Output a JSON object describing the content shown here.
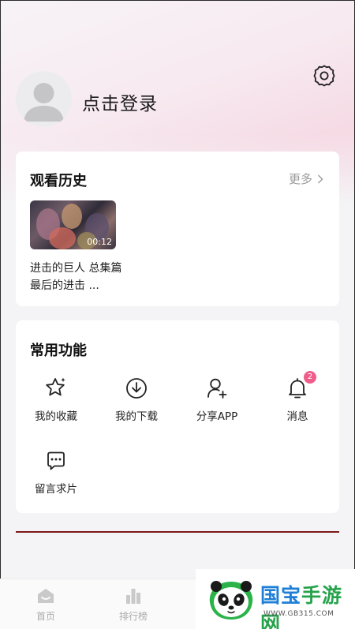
{
  "header": {
    "login_label": "点击登录",
    "settings_icon": "gear-icon",
    "avatar_icon": "default-avatar-icon"
  },
  "history": {
    "title": "观看历史",
    "more_label": "更多",
    "video": {
      "duration": "00:12",
      "title": "进击的巨人 总集篇 最后的进击 ..."
    }
  },
  "functions": {
    "title": "常用功能",
    "items": [
      {
        "label": "我的收藏",
        "icon": "star-icon"
      },
      {
        "label": "我的下载",
        "icon": "download-icon"
      },
      {
        "label": "分享APP",
        "icon": "add-user-icon"
      },
      {
        "label": "消息",
        "icon": "bell-icon",
        "badge": "2"
      },
      {
        "label": "留言求片",
        "icon": "message-icon"
      }
    ]
  },
  "tabbar": {
    "items": [
      {
        "label": "首页",
        "icon": "home-icon"
      },
      {
        "label": "排行榜",
        "icon": "bar-chart-icon"
      }
    ]
  },
  "watermark": {
    "brand_part1": "国宝",
    "brand_part2": "手游网",
    "url": "WWW.GB315.COM"
  },
  "colors": {
    "accent_pink": "#ef5d8b",
    "watermark_blue": "#1f7fd6",
    "watermark_green": "#25a24a"
  }
}
